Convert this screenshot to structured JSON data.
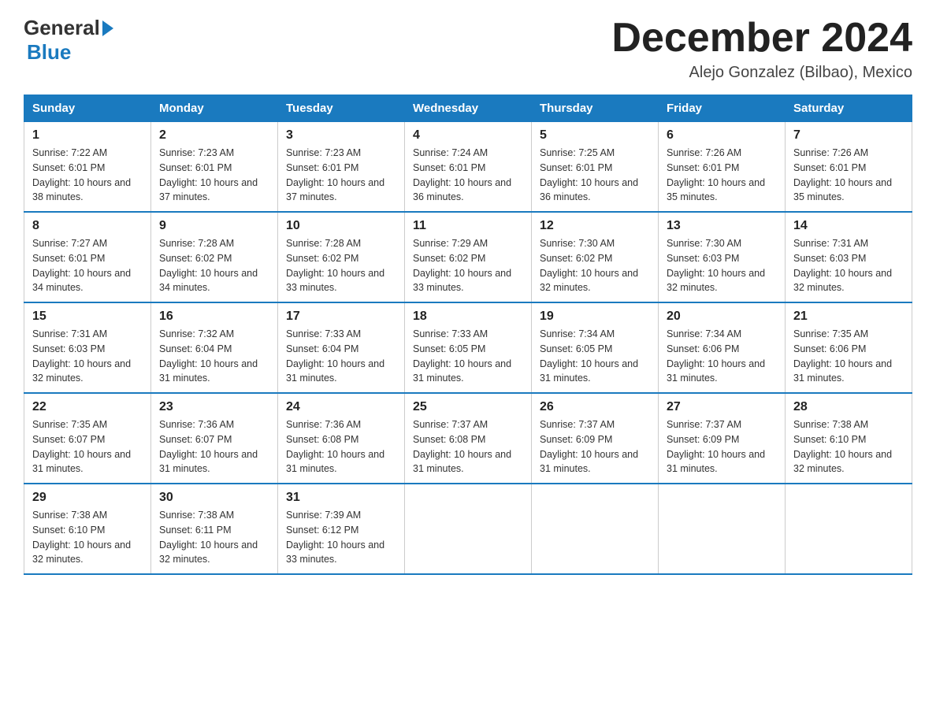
{
  "logo": {
    "general": "General",
    "blue": "Blue"
  },
  "title": "December 2024",
  "subtitle": "Alejo Gonzalez (Bilbao), Mexico",
  "days_of_week": [
    "Sunday",
    "Monday",
    "Tuesday",
    "Wednesday",
    "Thursday",
    "Friday",
    "Saturday"
  ],
  "weeks": [
    [
      {
        "day": "1",
        "sunrise": "7:22 AM",
        "sunset": "6:01 PM",
        "daylight": "10 hours and 38 minutes."
      },
      {
        "day": "2",
        "sunrise": "7:23 AM",
        "sunset": "6:01 PM",
        "daylight": "10 hours and 37 minutes."
      },
      {
        "day": "3",
        "sunrise": "7:23 AM",
        "sunset": "6:01 PM",
        "daylight": "10 hours and 37 minutes."
      },
      {
        "day": "4",
        "sunrise": "7:24 AM",
        "sunset": "6:01 PM",
        "daylight": "10 hours and 36 minutes."
      },
      {
        "day": "5",
        "sunrise": "7:25 AM",
        "sunset": "6:01 PM",
        "daylight": "10 hours and 36 minutes."
      },
      {
        "day": "6",
        "sunrise": "7:26 AM",
        "sunset": "6:01 PM",
        "daylight": "10 hours and 35 minutes."
      },
      {
        "day": "7",
        "sunrise": "7:26 AM",
        "sunset": "6:01 PM",
        "daylight": "10 hours and 35 minutes."
      }
    ],
    [
      {
        "day": "8",
        "sunrise": "7:27 AM",
        "sunset": "6:01 PM",
        "daylight": "10 hours and 34 minutes."
      },
      {
        "day": "9",
        "sunrise": "7:28 AM",
        "sunset": "6:02 PM",
        "daylight": "10 hours and 34 minutes."
      },
      {
        "day": "10",
        "sunrise": "7:28 AM",
        "sunset": "6:02 PM",
        "daylight": "10 hours and 33 minutes."
      },
      {
        "day": "11",
        "sunrise": "7:29 AM",
        "sunset": "6:02 PM",
        "daylight": "10 hours and 33 minutes."
      },
      {
        "day": "12",
        "sunrise": "7:30 AM",
        "sunset": "6:02 PM",
        "daylight": "10 hours and 32 minutes."
      },
      {
        "day": "13",
        "sunrise": "7:30 AM",
        "sunset": "6:03 PM",
        "daylight": "10 hours and 32 minutes."
      },
      {
        "day": "14",
        "sunrise": "7:31 AM",
        "sunset": "6:03 PM",
        "daylight": "10 hours and 32 minutes."
      }
    ],
    [
      {
        "day": "15",
        "sunrise": "7:31 AM",
        "sunset": "6:03 PM",
        "daylight": "10 hours and 32 minutes."
      },
      {
        "day": "16",
        "sunrise": "7:32 AM",
        "sunset": "6:04 PM",
        "daylight": "10 hours and 31 minutes."
      },
      {
        "day": "17",
        "sunrise": "7:33 AM",
        "sunset": "6:04 PM",
        "daylight": "10 hours and 31 minutes."
      },
      {
        "day": "18",
        "sunrise": "7:33 AM",
        "sunset": "6:05 PM",
        "daylight": "10 hours and 31 minutes."
      },
      {
        "day": "19",
        "sunrise": "7:34 AM",
        "sunset": "6:05 PM",
        "daylight": "10 hours and 31 minutes."
      },
      {
        "day": "20",
        "sunrise": "7:34 AM",
        "sunset": "6:06 PM",
        "daylight": "10 hours and 31 minutes."
      },
      {
        "day": "21",
        "sunrise": "7:35 AM",
        "sunset": "6:06 PM",
        "daylight": "10 hours and 31 minutes."
      }
    ],
    [
      {
        "day": "22",
        "sunrise": "7:35 AM",
        "sunset": "6:07 PM",
        "daylight": "10 hours and 31 minutes."
      },
      {
        "day": "23",
        "sunrise": "7:36 AM",
        "sunset": "6:07 PM",
        "daylight": "10 hours and 31 minutes."
      },
      {
        "day": "24",
        "sunrise": "7:36 AM",
        "sunset": "6:08 PM",
        "daylight": "10 hours and 31 minutes."
      },
      {
        "day": "25",
        "sunrise": "7:37 AM",
        "sunset": "6:08 PM",
        "daylight": "10 hours and 31 minutes."
      },
      {
        "day": "26",
        "sunrise": "7:37 AM",
        "sunset": "6:09 PM",
        "daylight": "10 hours and 31 minutes."
      },
      {
        "day": "27",
        "sunrise": "7:37 AM",
        "sunset": "6:09 PM",
        "daylight": "10 hours and 31 minutes."
      },
      {
        "day": "28",
        "sunrise": "7:38 AM",
        "sunset": "6:10 PM",
        "daylight": "10 hours and 32 minutes."
      }
    ],
    [
      {
        "day": "29",
        "sunrise": "7:38 AM",
        "sunset": "6:10 PM",
        "daylight": "10 hours and 32 minutes."
      },
      {
        "day": "30",
        "sunrise": "7:38 AM",
        "sunset": "6:11 PM",
        "daylight": "10 hours and 32 minutes."
      },
      {
        "day": "31",
        "sunrise": "7:39 AM",
        "sunset": "6:12 PM",
        "daylight": "10 hours and 33 minutes."
      },
      null,
      null,
      null,
      null
    ]
  ]
}
